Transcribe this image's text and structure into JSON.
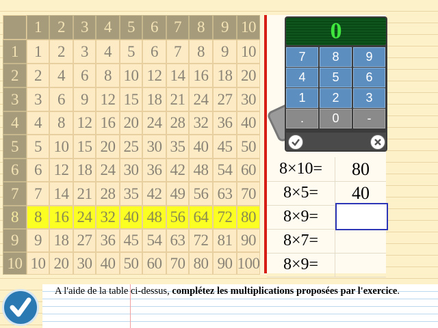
{
  "table": {
    "header_row": [
      "1",
      "2",
      "3",
      "4",
      "5",
      "6",
      "7",
      "8",
      "9",
      "10"
    ],
    "header_col": [
      "1",
      "2",
      "3",
      "4",
      "5",
      "6",
      "7",
      "8",
      "9",
      "10"
    ],
    "rows": [
      [
        "1",
        "2",
        "3",
        "4",
        "5",
        "6",
        "7",
        "8",
        "9",
        "10"
      ],
      [
        "2",
        "4",
        "6",
        "8",
        "10",
        "12",
        "14",
        "16",
        "18",
        "20"
      ],
      [
        "3",
        "6",
        "9",
        "12",
        "15",
        "18",
        "21",
        "24",
        "27",
        "30"
      ],
      [
        "4",
        "8",
        "12",
        "16",
        "20",
        "24",
        "28",
        "32",
        "36",
        "40"
      ],
      [
        "5",
        "10",
        "15",
        "20",
        "25",
        "30",
        "35",
        "40",
        "45",
        "50"
      ],
      [
        "6",
        "12",
        "18",
        "24",
        "30",
        "36",
        "42",
        "48",
        "54",
        "60"
      ],
      [
        "7",
        "14",
        "21",
        "28",
        "35",
        "42",
        "49",
        "56",
        "63",
        "70"
      ],
      [
        "8",
        "16",
        "24",
        "32",
        "40",
        "48",
        "56",
        "64",
        "72",
        "80"
      ],
      [
        "9",
        "18",
        "27",
        "36",
        "45",
        "54",
        "63",
        "72",
        "81",
        "90"
      ],
      [
        "10",
        "20",
        "30",
        "40",
        "50",
        "60",
        "70",
        "80",
        "90",
        "100"
      ]
    ],
    "highlighted_row": 8
  },
  "keypad": {
    "display": "0",
    "keys": [
      "7",
      "8",
      "9",
      "4",
      "5",
      "6",
      "1",
      "2",
      "3",
      ".",
      "0",
      "-"
    ]
  },
  "exercise": [
    {
      "question": "8×10=",
      "answer": "80"
    },
    {
      "question": "8×5=",
      "answer": "40"
    },
    {
      "question": "8×9=",
      "answer": ""
    },
    {
      "question": "8×7=",
      "answer": ""
    },
    {
      "question": "8×9=",
      "answer": ""
    }
  ],
  "instruction": {
    "prefix": "A l'aide de la table ci-dessus, ",
    "bold": "complétez les multiplications proposées par l'exercice",
    "suffix": "."
  },
  "colors": {
    "highlight": "#fbff22",
    "header": "#a69c7c",
    "keypad_key": "#5d8ec0",
    "display_text": "#3fe63d",
    "active_input_border": "#2e36b8"
  }
}
